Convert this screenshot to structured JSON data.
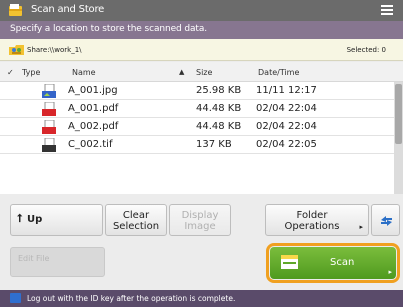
{
  "app": {
    "title": "Scan and Store",
    "menu_icon": "hamburger-menu-icon"
  },
  "instruction": "Specify a location to store the scanned data.",
  "location": {
    "name": "Share:\\\\work_1\\",
    "selected_label": "Selected: 0"
  },
  "table": {
    "headers": {
      "type": "Type",
      "name": "Name",
      "size": "Size",
      "datetime": "Date/Time"
    },
    "sort": "name-ascending",
    "rows": [
      {
        "name": "A_001.jpg",
        "size": "25.98 KB",
        "datetime": "11/11  12:17",
        "icon": "image-file-icon"
      },
      {
        "name": "A_001.pdf",
        "size": "44.48 KB",
        "datetime": "02/04  22:04",
        "icon": "pdf-file-icon"
      },
      {
        "name": "A_002.pdf",
        "size": "44.48 KB",
        "datetime": "02/04  22:04",
        "icon": "pdf-file-icon"
      },
      {
        "name": "C_002.tif",
        "size": "137 KB",
        "datetime": "02/04  22:05",
        "icon": "tiff-file-icon"
      }
    ]
  },
  "toolbar": {
    "up_label": "Up",
    "clear_line1": "Clear",
    "clear_line2": "Selection",
    "display_line1": "Display",
    "display_line2": "Image",
    "folder_line1": "Folder",
    "folder_line2": "Operations",
    "edit_file_label": "Edit File",
    "scan_label": "Scan"
  },
  "status": "Log out with the ID key after the operation is complete.",
  "colors": {
    "title_bar": "#6b6b6b",
    "instruction_bar": "#877690",
    "scan_button": "#5fa829",
    "scan_highlight": "#f0a020",
    "status_bar": "#5a4b6a"
  }
}
